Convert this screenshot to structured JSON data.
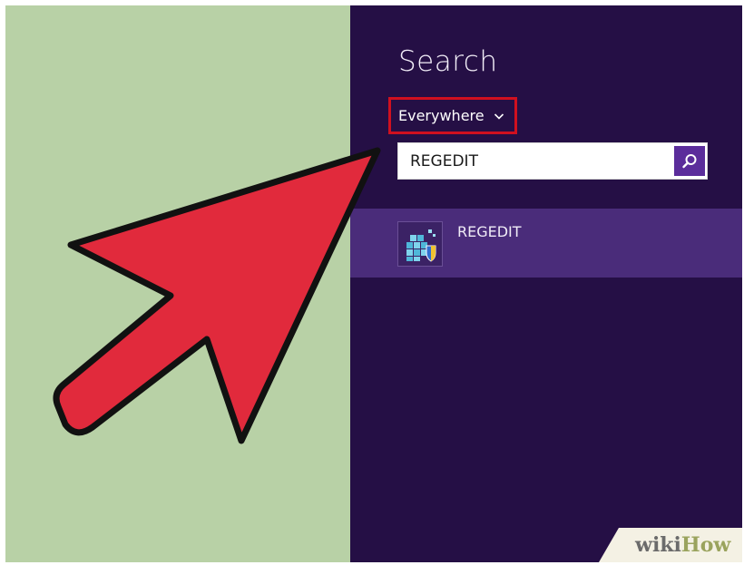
{
  "charm": {
    "title": "Search",
    "scope_label": "Everywhere",
    "scope_icon": "chevron-down-icon",
    "search_value": "REGEDIT",
    "search_icon": "magnifier-icon",
    "accent_color": "#5b2d9b",
    "background_color": "#250f45",
    "results": [
      {
        "label": "REGEDIT",
        "icon": "registry-editor-icon"
      }
    ]
  },
  "annotations": {
    "highlight_color": "#d0101f",
    "arrow_color": "#e12a3c"
  },
  "watermark": {
    "part1": "wiki",
    "part2": "How"
  }
}
